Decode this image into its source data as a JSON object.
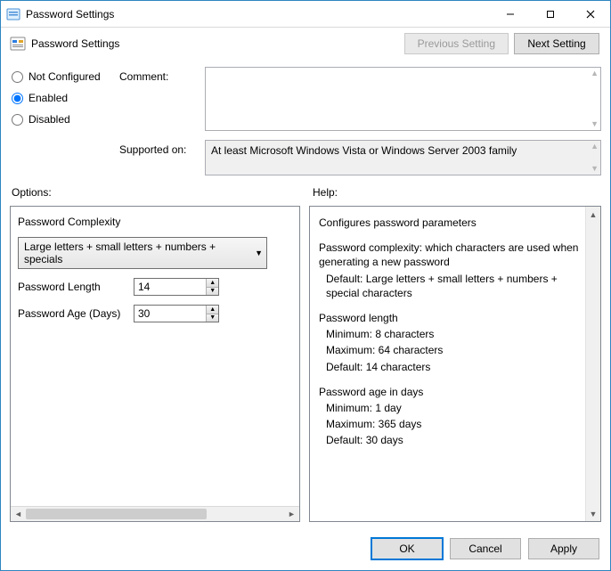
{
  "window": {
    "title": "Password Settings"
  },
  "header": {
    "label": "Password Settings",
    "prev_label": "Previous Setting",
    "next_label": "Next Setting"
  },
  "state": {
    "not_configured_label": "Not Configured",
    "enabled_label": "Enabled",
    "disabled_label": "Disabled",
    "selected": "Enabled"
  },
  "comment": {
    "label": "Comment:",
    "value": ""
  },
  "supported": {
    "label": "Supported on:",
    "value": "At least Microsoft Windows Vista or Windows Server 2003 family"
  },
  "sections": {
    "options_label": "Options:",
    "help_label": "Help:"
  },
  "options": {
    "complexity_label": "Password Complexity",
    "complexity_value": "Large letters + small letters + numbers + specials",
    "length_label": "Password Length",
    "length_value": "14",
    "age_label": "Password Age (Days)",
    "age_value": "30"
  },
  "help": {
    "l1": "Configures password parameters",
    "l2a": "Password complexity: which characters are used when generating a new password",
    "l2b": "Default: Large letters + small letters + numbers + special characters",
    "l3_head": "Password length",
    "l3_min": "Minimum: 8 characters",
    "l3_max": "Maximum: 64 characters",
    "l3_def": "Default: 14 characters",
    "l4_head": "Password age in days",
    "l4_min": "Minimum: 1 day",
    "l4_max": "Maximum: 365 days",
    "l4_def": "Default: 30 days"
  },
  "footer": {
    "ok": "OK",
    "cancel": "Cancel",
    "apply": "Apply"
  }
}
